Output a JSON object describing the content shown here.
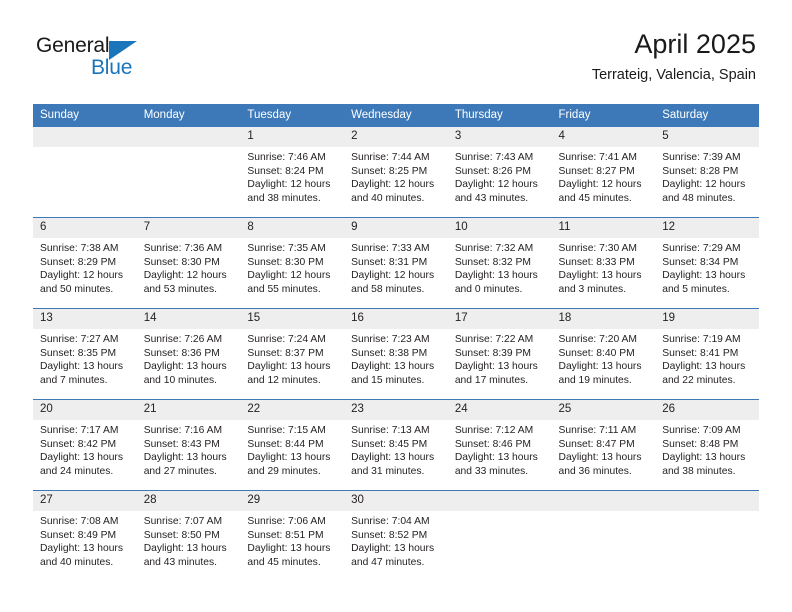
{
  "brand": {
    "name_top": "General",
    "name_bottom": "Blue",
    "accent_color": "#1b75bb"
  },
  "header": {
    "title": "April 2025",
    "subtitle": "Terrateig, Valencia, Spain"
  },
  "calendar": {
    "header_bg": "#3d79b8",
    "daynum_bg": "#eeeeee",
    "weekdays": [
      "Sunday",
      "Monday",
      "Tuesday",
      "Wednesday",
      "Thursday",
      "Friday",
      "Saturday"
    ],
    "weeks": [
      [
        {
          "day": "",
          "empty": true
        },
        {
          "day": "",
          "empty": true
        },
        {
          "day": "1",
          "sunrise": "Sunrise: 7:46 AM",
          "sunset": "Sunset: 8:24 PM",
          "daylight1": "Daylight: 12 hours",
          "daylight2": "and 38 minutes."
        },
        {
          "day": "2",
          "sunrise": "Sunrise: 7:44 AM",
          "sunset": "Sunset: 8:25 PM",
          "daylight1": "Daylight: 12 hours",
          "daylight2": "and 40 minutes."
        },
        {
          "day": "3",
          "sunrise": "Sunrise: 7:43 AM",
          "sunset": "Sunset: 8:26 PM",
          "daylight1": "Daylight: 12 hours",
          "daylight2": "and 43 minutes."
        },
        {
          "day": "4",
          "sunrise": "Sunrise: 7:41 AM",
          "sunset": "Sunset: 8:27 PM",
          "daylight1": "Daylight: 12 hours",
          "daylight2": "and 45 minutes."
        },
        {
          "day": "5",
          "sunrise": "Sunrise: 7:39 AM",
          "sunset": "Sunset: 8:28 PM",
          "daylight1": "Daylight: 12 hours",
          "daylight2": "and 48 minutes."
        }
      ],
      [
        {
          "day": "6",
          "sunrise": "Sunrise: 7:38 AM",
          "sunset": "Sunset: 8:29 PM",
          "daylight1": "Daylight: 12 hours",
          "daylight2": "and 50 minutes."
        },
        {
          "day": "7",
          "sunrise": "Sunrise: 7:36 AM",
          "sunset": "Sunset: 8:30 PM",
          "daylight1": "Daylight: 12 hours",
          "daylight2": "and 53 minutes."
        },
        {
          "day": "8",
          "sunrise": "Sunrise: 7:35 AM",
          "sunset": "Sunset: 8:30 PM",
          "daylight1": "Daylight: 12 hours",
          "daylight2": "and 55 minutes."
        },
        {
          "day": "9",
          "sunrise": "Sunrise: 7:33 AM",
          "sunset": "Sunset: 8:31 PM",
          "daylight1": "Daylight: 12 hours",
          "daylight2": "and 58 minutes."
        },
        {
          "day": "10",
          "sunrise": "Sunrise: 7:32 AM",
          "sunset": "Sunset: 8:32 PM",
          "daylight1": "Daylight: 13 hours",
          "daylight2": "and 0 minutes."
        },
        {
          "day": "11",
          "sunrise": "Sunrise: 7:30 AM",
          "sunset": "Sunset: 8:33 PM",
          "daylight1": "Daylight: 13 hours",
          "daylight2": "and 3 minutes."
        },
        {
          "day": "12",
          "sunrise": "Sunrise: 7:29 AM",
          "sunset": "Sunset: 8:34 PM",
          "daylight1": "Daylight: 13 hours",
          "daylight2": "and 5 minutes."
        }
      ],
      [
        {
          "day": "13",
          "sunrise": "Sunrise: 7:27 AM",
          "sunset": "Sunset: 8:35 PM",
          "daylight1": "Daylight: 13 hours",
          "daylight2": "and 7 minutes."
        },
        {
          "day": "14",
          "sunrise": "Sunrise: 7:26 AM",
          "sunset": "Sunset: 8:36 PM",
          "daylight1": "Daylight: 13 hours",
          "daylight2": "and 10 minutes."
        },
        {
          "day": "15",
          "sunrise": "Sunrise: 7:24 AM",
          "sunset": "Sunset: 8:37 PM",
          "daylight1": "Daylight: 13 hours",
          "daylight2": "and 12 minutes."
        },
        {
          "day": "16",
          "sunrise": "Sunrise: 7:23 AM",
          "sunset": "Sunset: 8:38 PM",
          "daylight1": "Daylight: 13 hours",
          "daylight2": "and 15 minutes."
        },
        {
          "day": "17",
          "sunrise": "Sunrise: 7:22 AM",
          "sunset": "Sunset: 8:39 PM",
          "daylight1": "Daylight: 13 hours",
          "daylight2": "and 17 minutes."
        },
        {
          "day": "18",
          "sunrise": "Sunrise: 7:20 AM",
          "sunset": "Sunset: 8:40 PM",
          "daylight1": "Daylight: 13 hours",
          "daylight2": "and 19 minutes."
        },
        {
          "day": "19",
          "sunrise": "Sunrise: 7:19 AM",
          "sunset": "Sunset: 8:41 PM",
          "daylight1": "Daylight: 13 hours",
          "daylight2": "and 22 minutes."
        }
      ],
      [
        {
          "day": "20",
          "sunrise": "Sunrise: 7:17 AM",
          "sunset": "Sunset: 8:42 PM",
          "daylight1": "Daylight: 13 hours",
          "daylight2": "and 24 minutes."
        },
        {
          "day": "21",
          "sunrise": "Sunrise: 7:16 AM",
          "sunset": "Sunset: 8:43 PM",
          "daylight1": "Daylight: 13 hours",
          "daylight2": "and 27 minutes."
        },
        {
          "day": "22",
          "sunrise": "Sunrise: 7:15 AM",
          "sunset": "Sunset: 8:44 PM",
          "daylight1": "Daylight: 13 hours",
          "daylight2": "and 29 minutes."
        },
        {
          "day": "23",
          "sunrise": "Sunrise: 7:13 AM",
          "sunset": "Sunset: 8:45 PM",
          "daylight1": "Daylight: 13 hours",
          "daylight2": "and 31 minutes."
        },
        {
          "day": "24",
          "sunrise": "Sunrise: 7:12 AM",
          "sunset": "Sunset: 8:46 PM",
          "daylight1": "Daylight: 13 hours",
          "daylight2": "and 33 minutes."
        },
        {
          "day": "25",
          "sunrise": "Sunrise: 7:11 AM",
          "sunset": "Sunset: 8:47 PM",
          "daylight1": "Daylight: 13 hours",
          "daylight2": "and 36 minutes."
        },
        {
          "day": "26",
          "sunrise": "Sunrise: 7:09 AM",
          "sunset": "Sunset: 8:48 PM",
          "daylight1": "Daylight: 13 hours",
          "daylight2": "and 38 minutes."
        }
      ],
      [
        {
          "day": "27",
          "sunrise": "Sunrise: 7:08 AM",
          "sunset": "Sunset: 8:49 PM",
          "daylight1": "Daylight: 13 hours",
          "daylight2": "and 40 minutes."
        },
        {
          "day": "28",
          "sunrise": "Sunrise: 7:07 AM",
          "sunset": "Sunset: 8:50 PM",
          "daylight1": "Daylight: 13 hours",
          "daylight2": "and 43 minutes."
        },
        {
          "day": "29",
          "sunrise": "Sunrise: 7:06 AM",
          "sunset": "Sunset: 8:51 PM",
          "daylight1": "Daylight: 13 hours",
          "daylight2": "and 45 minutes."
        },
        {
          "day": "30",
          "sunrise": "Sunrise: 7:04 AM",
          "sunset": "Sunset: 8:52 PM",
          "daylight1": "Daylight: 13 hours",
          "daylight2": "and 47 minutes."
        },
        {
          "day": "",
          "empty": true
        },
        {
          "day": "",
          "empty": true
        },
        {
          "day": "",
          "empty": true
        }
      ]
    ]
  }
}
